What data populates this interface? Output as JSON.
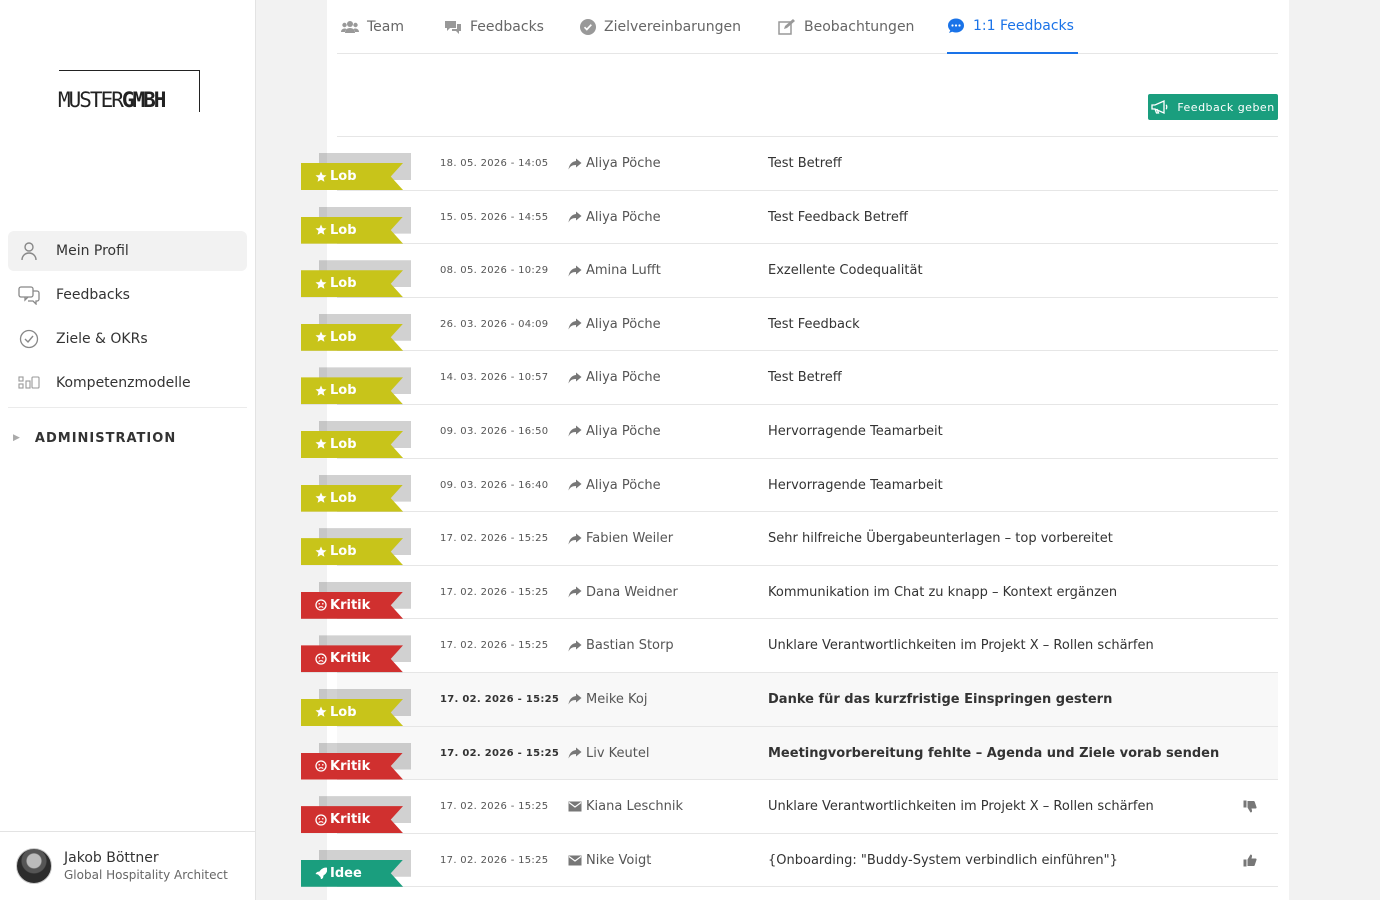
{
  "brand": {
    "logo_light": "MUSTER",
    "logo_bold": "GMBH"
  },
  "colors": {
    "lob": "#c8c41a",
    "kritik": "#d0302f",
    "idee": "#1a9e7e",
    "accent": "#1a73e8"
  },
  "sidebar": {
    "items": [
      {
        "label": "Mein Profil",
        "icon": "person-icon",
        "active": true
      },
      {
        "label": "Feedbacks",
        "icon": "chat-icon",
        "active": false
      },
      {
        "label": "Ziele & OKRs",
        "icon": "check-circle-icon",
        "active": false
      },
      {
        "label": "Kompetenzmodelle",
        "icon": "grid-icon",
        "active": false
      }
    ],
    "admin_label": "ADMINISTRATION"
  },
  "user": {
    "name": "Jakob Böttner",
    "role": "Global Hospitality Architect"
  },
  "tabs": [
    {
      "label": "Team",
      "icon": "users-icon"
    },
    {
      "label": "Feedbacks",
      "icon": "comments-icon"
    },
    {
      "label": "Zielvereinbarungen",
      "icon": "check-circle-icon"
    },
    {
      "label": "Beobachtungen",
      "icon": "edit-icon"
    },
    {
      "label": "1:1 Feedbacks",
      "icon": "chat-bubble-icon"
    }
  ],
  "feedback_button": "Feedback geben",
  "rows": [
    {
      "type": "Lob",
      "date": "18. 05. 2026 - 14:05",
      "person": "Aliya Pöche",
      "via": "share",
      "subject": "Test Betreff",
      "bold": false,
      "thumb": ""
    },
    {
      "type": "Lob",
      "date": "15. 05. 2026 - 14:55",
      "person": "Aliya Pöche",
      "via": "share",
      "subject": "Test Feedback Betreff",
      "bold": false,
      "thumb": ""
    },
    {
      "type": "Lob",
      "date": "08. 05. 2026 - 10:29",
      "person": "Amina Lufft",
      "via": "share",
      "subject": "Exzellente Codequalität",
      "bold": false,
      "thumb": ""
    },
    {
      "type": "Lob",
      "date": "26. 03. 2026 - 04:09",
      "person": "Aliya Pöche",
      "via": "share",
      "subject": "Test Feedback",
      "bold": false,
      "thumb": ""
    },
    {
      "type": "Lob",
      "date": "14. 03. 2026 - 10:57",
      "person": "Aliya Pöche",
      "via": "share",
      "subject": "Test Betreff",
      "bold": false,
      "thumb": ""
    },
    {
      "type": "Lob",
      "date": "09. 03. 2026 - 16:50",
      "person": "Aliya Pöche",
      "via": "share",
      "subject": "Hervorragende Teamarbeit",
      "bold": false,
      "thumb": ""
    },
    {
      "type": "Lob",
      "date": "09. 03. 2026 - 16:40",
      "person": "Aliya Pöche",
      "via": "share",
      "subject": "Hervorragende Teamarbeit",
      "bold": false,
      "thumb": ""
    },
    {
      "type": "Lob",
      "date": "17. 02. 2026 - 15:25",
      "person": "Fabien Weiler",
      "via": "share",
      "subject": "Sehr hilfreiche Übergabeunterlagen – top vorbereitet",
      "bold": false,
      "thumb": ""
    },
    {
      "type": "Kritik",
      "date": "17. 02. 2026 - 15:25",
      "person": "Dana Weidner",
      "via": "share",
      "subject": "Kommunikation im Chat zu knapp – Kontext ergänzen",
      "bold": false,
      "thumb": ""
    },
    {
      "type": "Kritik",
      "date": "17. 02. 2026 - 15:25",
      "person": "Bastian Storp",
      "via": "share",
      "subject": "Unklare Verantwortlichkeiten im Projekt X – Rollen schärfen",
      "bold": false,
      "thumb": ""
    },
    {
      "type": "Lob",
      "date": "17. 02. 2026 - 15:25",
      "person": "Meike Koj",
      "via": "share",
      "subject": "Danke für das kurzfristige Einspringen gestern",
      "bold": true,
      "thumb": ""
    },
    {
      "type": "Kritik",
      "date": "17. 02. 2026 - 15:25",
      "person": "Liv Keutel",
      "via": "share",
      "subject": "Meetingvorbereitung fehlte – Agenda und Ziele vorab senden",
      "bold": true,
      "thumb": ""
    },
    {
      "type": "Kritik",
      "date": "17. 02. 2026 - 15:25",
      "person": "Kiana Leschnik",
      "via": "mail",
      "subject": "Unklare Verantwortlichkeiten im Projekt X – Rollen schärfen",
      "bold": false,
      "thumb": "down"
    },
    {
      "type": "Idee",
      "date": "17. 02. 2026 - 15:25",
      "person": "Nike Voigt",
      "via": "mail",
      "subject": "{Onboarding: \"Buddy-System verbindlich einführen\"}",
      "bold": false,
      "thumb": "up"
    }
  ]
}
